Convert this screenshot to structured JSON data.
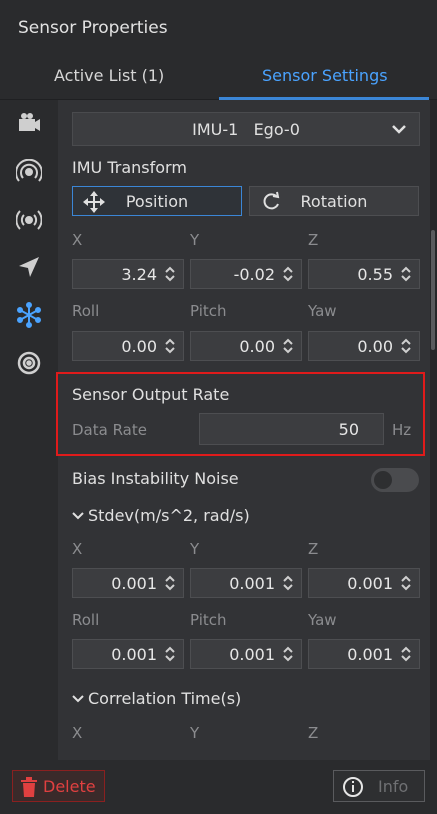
{
  "window": {
    "title": "Sensor Properties"
  },
  "tabs": [
    {
      "label": "Active List  (1)",
      "active": false
    },
    {
      "label": "Sensor Settings",
      "active": true
    }
  ],
  "sidebar_icons": [
    "camera-icon",
    "radar-icon",
    "broadcast-icon",
    "navigation-arrow-icon",
    "imu-star-icon",
    "target-icon"
  ],
  "sensor_select": {
    "value": "IMU-1   Ego-0"
  },
  "imu_transform": {
    "heading": "IMU Transform",
    "position_label": "Position",
    "rotation_label": "Rotation",
    "xyz_labels": [
      "X",
      "Y",
      "Z"
    ],
    "xyz_values": [
      "3.24",
      "-0.02",
      "0.55"
    ],
    "rpy_labels": [
      "Roll",
      "Pitch",
      "Yaw"
    ],
    "rpy_values": [
      "0.00",
      "0.00",
      "0.00"
    ]
  },
  "output_rate": {
    "heading": "Sensor Output Rate",
    "field_label": "Data Rate",
    "value": "50",
    "unit": "Hz"
  },
  "bias": {
    "label": "Bias Instability Noise",
    "enabled": false
  },
  "stdev": {
    "heading": "Stdev(m/s^2, rad/s)",
    "xyz_labels": [
      "X",
      "Y",
      "Z"
    ],
    "xyz_values": [
      "0.001",
      "0.001",
      "0.001"
    ],
    "rpy_labels": [
      "Roll",
      "Pitch",
      "Yaw"
    ],
    "rpy_values": [
      "0.001",
      "0.001",
      "0.001"
    ]
  },
  "correlation": {
    "heading": "Correlation Time(s)",
    "xyz_labels": [
      "X",
      "Y",
      "Z"
    ]
  },
  "footer": {
    "delete_label": "Delete",
    "info_label": "Info"
  },
  "colors": {
    "accent": "#3b86d6",
    "danger": "#e04040",
    "highlight": "#e01b1b"
  }
}
